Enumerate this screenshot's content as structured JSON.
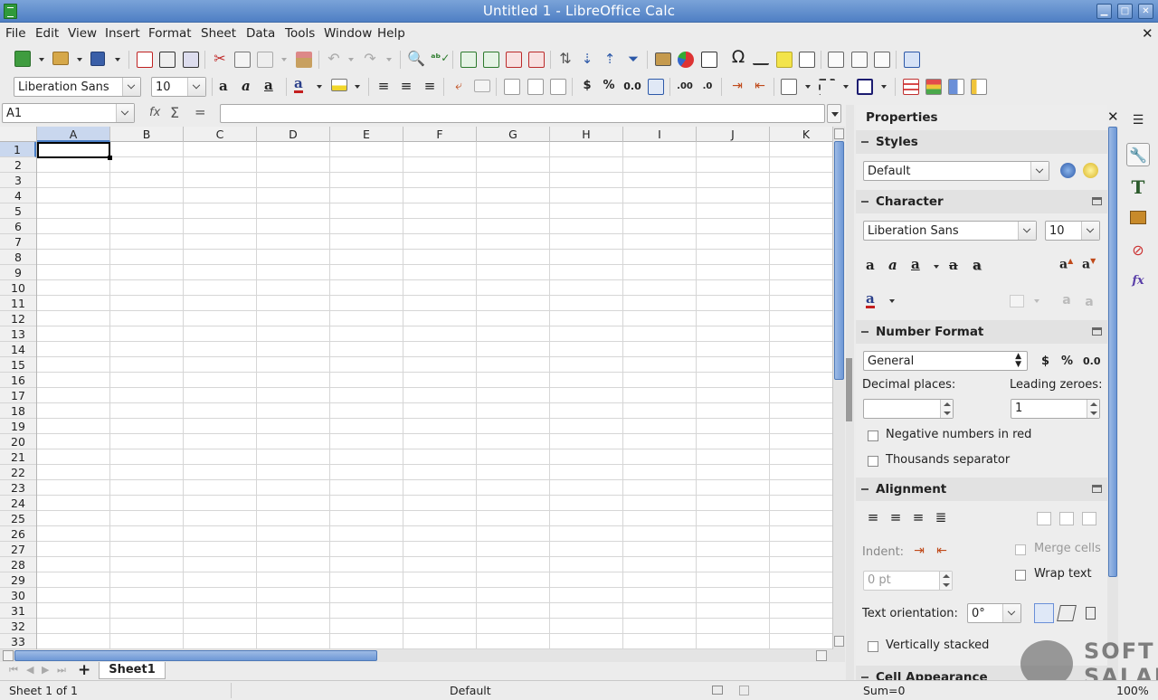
{
  "window": {
    "title": "Untitled 1 - LibreOffice Calc"
  },
  "menu": [
    "File",
    "Edit",
    "View",
    "Insert",
    "Format",
    "Sheet",
    "Data",
    "Tools",
    "Window",
    "Help"
  ],
  "formatting": {
    "font_name": "Liberation Sans",
    "font_size": "10",
    "currency": "$",
    "percent": "%",
    "decimal": "0.0"
  },
  "formula_bar": {
    "name_box": "A1",
    "function_wizard": "fx",
    "sum": "Σ",
    "equals": "=",
    "content": ""
  },
  "columns": [
    "A",
    "B",
    "C",
    "D",
    "E",
    "F",
    "G",
    "H",
    "I",
    "J",
    "K"
  ],
  "rows": [
    "1",
    "2",
    "3",
    "4",
    "5",
    "6",
    "7",
    "8",
    "9",
    "10",
    "11",
    "12",
    "13",
    "14",
    "15",
    "16",
    "17",
    "18",
    "19",
    "20",
    "21",
    "22",
    "23",
    "24",
    "25",
    "26",
    "27",
    "28",
    "29",
    "30",
    "31",
    "32",
    "33"
  ],
  "sheet_tabs": {
    "add": "+",
    "active": "Sheet1"
  },
  "status_bar": {
    "sheet_pos": "Sheet 1 of 1",
    "page_style": "Default",
    "sum": "Sum=0",
    "zoom": "100%"
  },
  "sidebar": {
    "title": "Properties",
    "styles": {
      "header": "Styles",
      "value": "Default"
    },
    "character": {
      "header": "Character",
      "font": "Liberation Sans",
      "size": "10"
    },
    "number_format": {
      "header": "Number Format",
      "value": "General",
      "currency": "$",
      "percent": "%",
      "decimal": "0.0",
      "decimal_places_label": "Decimal places:",
      "decimal_places_value": "",
      "leading_zeroes_label": "Leading zeroes:",
      "leading_zeroes_value": "1",
      "negative_red": "Negative numbers in red",
      "thousands_sep": "Thousands separator"
    },
    "alignment": {
      "header": "Alignment",
      "indent_label": "Indent:",
      "indent_value": "0 pt",
      "merge_cells": "Merge cells",
      "wrap_text": "Wrap text",
      "text_orientation_label": "Text orientation:",
      "text_orientation_value": "0°",
      "vertically_stacked": "Vertically stacked"
    },
    "next_header": "Cell Appearance"
  },
  "watermark": {
    "line1": "SOFT",
    "line2": "SALAD"
  },
  "colors": {
    "titlebar": "#5a87c8",
    "active_header": "#c5d6ef",
    "accent": "#4a7fc6"
  }
}
